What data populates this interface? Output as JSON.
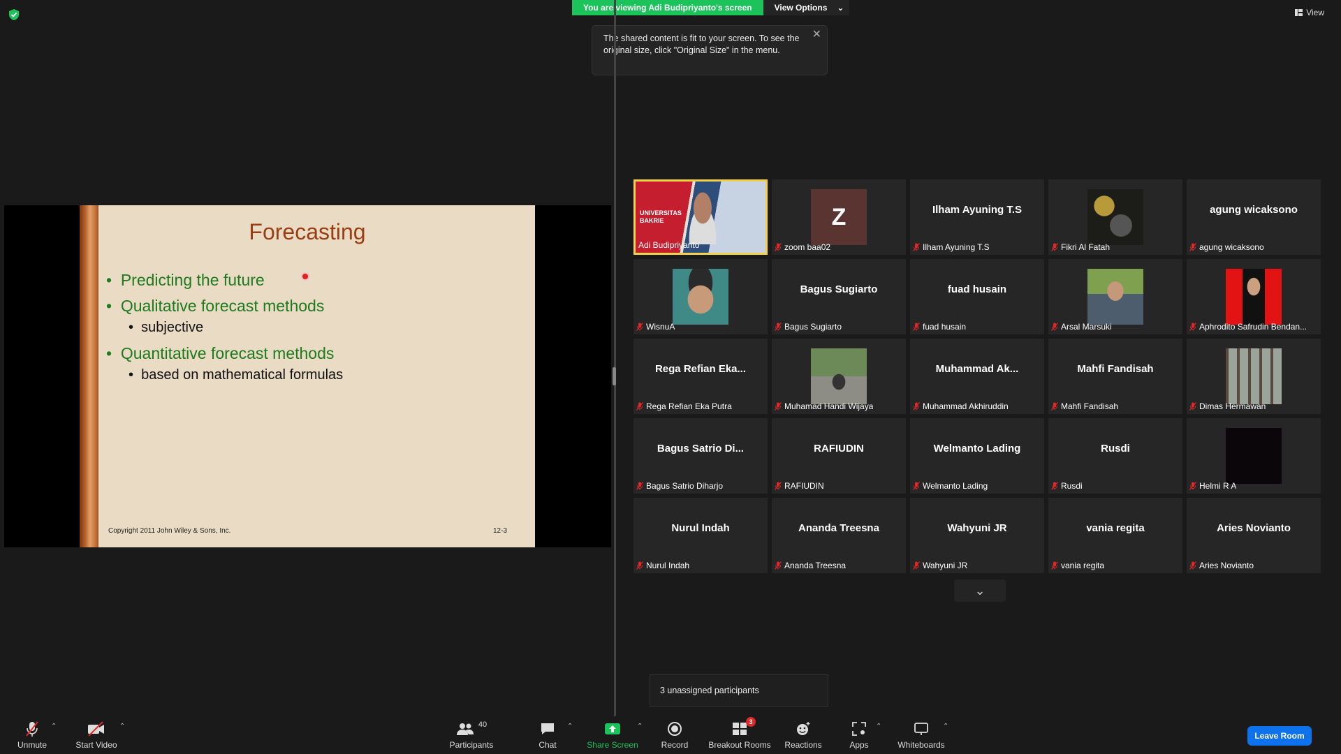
{
  "top": {
    "banner_text": "You are viewing Adi Budipriyanto's screen",
    "view_options_label": "View Options",
    "view_label": "View",
    "tooltip_text": "The shared content is fit to your screen. To see the original size, click \"Original Size\" in the menu."
  },
  "slide": {
    "title": "Forecasting",
    "bullets": [
      {
        "text": "Predicting the future"
      },
      {
        "text": "Qualitative forecast methods",
        "sub": "subjective"
      },
      {
        "text": "Quantitative forecast methods",
        "sub": "based on mathematical formulas"
      }
    ],
    "copyright": "Copyright 2011 John Wiley & Sons, Inc.",
    "page": "12-3"
  },
  "gallery": {
    "tiles": [
      {
        "name": "Adi Budipriyanto",
        "display": "",
        "type": "video",
        "active": true,
        "overlay": "UNIVERSITAS BAKRIE"
      },
      {
        "name": "zoom baa02",
        "display": "Z",
        "type": "letter"
      },
      {
        "name": "Ilham Ayuning T.S",
        "display": "Ilham Ayuning T.S",
        "type": "text"
      },
      {
        "name": "Fikri Al Fatah",
        "display": "",
        "type": "photo",
        "photo": "dark-gold"
      },
      {
        "name": "agung wicaksono",
        "display": "agung wicaksono",
        "type": "text"
      },
      {
        "name": "WisnuA",
        "display": "",
        "type": "photo",
        "photo": "teal"
      },
      {
        "name": "Bagus Sugiarto",
        "display": "Bagus Sugiarto",
        "type": "text"
      },
      {
        "name": "fuad husain",
        "display": "fuad husain",
        "type": "text"
      },
      {
        "name": "Arsal Marsuki",
        "display": "",
        "type": "photo",
        "photo": "outdoor"
      },
      {
        "name": "Aphrodito Safrudin Bendan...",
        "display": "",
        "type": "photo",
        "photo": "red"
      },
      {
        "name": "Rega Refian Eka Putra",
        "display": "Rega Refian Eka...",
        "type": "text"
      },
      {
        "name": "Muhamad Handi Wijaya",
        "display": "",
        "type": "photo",
        "photo": "road"
      },
      {
        "name": "Muhammad Akhiruddin",
        "display": "Muhammad Ak...",
        "type": "text"
      },
      {
        "name": "Mahfi Fandisah",
        "display": "Mahfi Fandisah",
        "type": "text"
      },
      {
        "name": "Dimas Hermawan",
        "display": "",
        "type": "photo",
        "photo": "forest"
      },
      {
        "name": "Bagus Satrio Diharjo",
        "display": "Bagus Satrio Di...",
        "type": "text"
      },
      {
        "name": "RAFIUDIN",
        "display": "RAFIUDIN",
        "type": "text"
      },
      {
        "name": "Welmanto Lading",
        "display": "Welmanto Lading",
        "type": "text"
      },
      {
        "name": "Rusdi",
        "display": "Rusdi",
        "type": "text"
      },
      {
        "name": "Helmi R A",
        "display": "",
        "type": "photo",
        "photo": "black"
      },
      {
        "name": "Nurul Indah",
        "display": "Nurul Indah",
        "type": "text"
      },
      {
        "name": "Ananda Treesna",
        "display": "Ananda Treesna",
        "type": "text"
      },
      {
        "name": "Wahyuni JR",
        "display": "Wahyuni JR",
        "type": "text"
      },
      {
        "name": "vania regita",
        "display": "vania regita",
        "type": "text"
      },
      {
        "name": "Aries Novianto",
        "display": "Aries Novianto",
        "type": "text"
      }
    ]
  },
  "unassigned": "3 unassigned participants",
  "toolbar": {
    "unmute": "Unmute",
    "start_video": "Start Video",
    "participants": "Participants",
    "participants_count": "40",
    "chat": "Chat",
    "share_screen": "Share Screen",
    "record": "Record",
    "breakout_rooms": "Breakout Rooms",
    "breakout_badge": "3",
    "reactions": "Reactions",
    "apps": "Apps",
    "whiteboards": "Whiteboards",
    "leave": "Leave Room"
  },
  "colors": {
    "share_green": "#1cc35b",
    "leave_blue": "#0e72ed",
    "mute_red": "#e02828",
    "active_speaker": "#f3d24a"
  }
}
